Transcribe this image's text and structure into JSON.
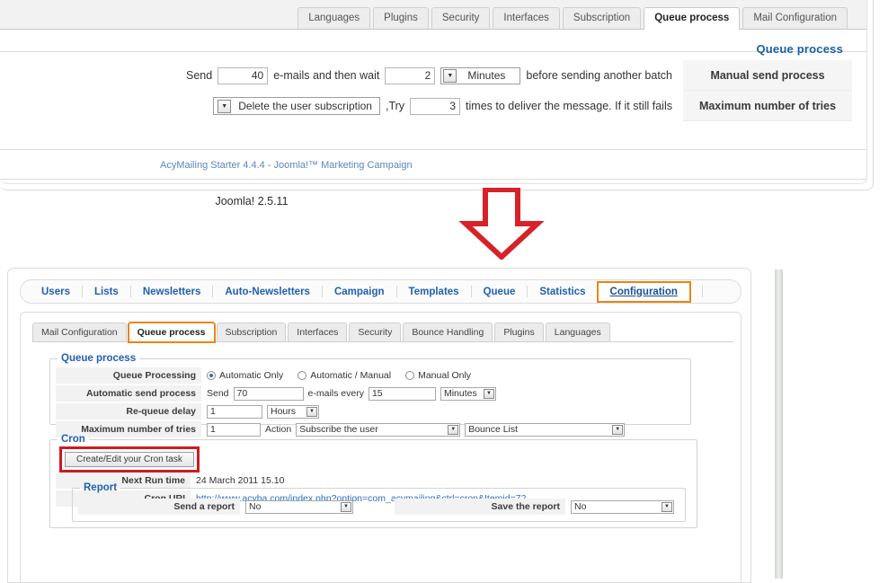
{
  "top_panel": {
    "tabs": [
      {
        "label": "Languages",
        "active": false
      },
      {
        "label": "Plugins",
        "active": false
      },
      {
        "label": "Security",
        "active": false
      },
      {
        "label": "Interfaces",
        "active": false
      },
      {
        "label": "Subscription",
        "active": false
      },
      {
        "label": "Queue process",
        "active": true
      },
      {
        "label": "Mail Configuration",
        "active": false
      }
    ],
    "legend": "Queue process",
    "row1": {
      "label_send": "Send",
      "emails_value": "40",
      "text_after_emails": "e-mails and then wait",
      "wait_value": "2",
      "unit": "Minutes",
      "text_tail": "before sending another batch",
      "side_label": "Manual send process"
    },
    "row2": {
      "action": "Delete the user subscription",
      "try_text": ",Try",
      "try_value": "3",
      "text_tail": "times to deliver the message. If it still fails",
      "side_label": "Maximum number of tries"
    },
    "acymailing_footer": "AcyMailing Starter 4.4.4 - Joomla!™ Marketing Campaign"
  },
  "middle": {
    "joomla_version": "Joomla! 2.5.11",
    "arrow_color": "#d82128"
  },
  "bottom_panel": {
    "main_nav": [
      {
        "label": "Users",
        "highlight": false
      },
      {
        "label": "Lists",
        "highlight": false
      },
      {
        "label": "Newsletters",
        "highlight": false
      },
      {
        "label": "Auto-Newsletters",
        "highlight": false
      },
      {
        "label": "Campaign",
        "highlight": false
      },
      {
        "label": "Templates",
        "highlight": false
      },
      {
        "label": "Queue",
        "highlight": false
      },
      {
        "label": "Statistics",
        "highlight": false
      },
      {
        "label": "Configuration",
        "highlight": true
      }
    ],
    "sub_tabs": [
      {
        "label": "Mail Configuration",
        "active": false
      },
      {
        "label": "Queue process",
        "active": true
      },
      {
        "label": "Subscription",
        "active": false
      },
      {
        "label": "Interfaces",
        "active": false
      },
      {
        "label": "Security",
        "active": false
      },
      {
        "label": "Bounce Handling",
        "active": false
      },
      {
        "label": "Plugins",
        "active": false
      },
      {
        "label": "Languages",
        "active": false
      }
    ],
    "queue_fieldset": {
      "legend": "Queue process",
      "queue_processing_label": "Queue Processing",
      "radios": [
        {
          "label": "Automatic Only",
          "selected": true
        },
        {
          "label": "Automatic / Manual",
          "selected": false
        },
        {
          "label": "Manual Only",
          "selected": false
        }
      ],
      "auto_send_label": "Automatic send process",
      "auto_send_prefix": "Send",
      "auto_send_count": "70",
      "auto_send_mid": "e-mails every",
      "auto_send_interval": "15",
      "auto_send_unit": "Minutes",
      "requeue_label": "Re-queue delay",
      "requeue_value": "1",
      "requeue_unit": "Hours",
      "max_tries_label": "Maximum number of tries",
      "max_tries_value": "1",
      "action_label": "Action",
      "action_value": "Subscribe the user",
      "list_value": "Bounce List"
    },
    "cron_fieldset": {
      "legend": "Cron",
      "button_label": "Create/Edit your Cron task",
      "next_run_label": "Next Run time",
      "next_run_value": "24 March 2011 15.10",
      "cron_uri_label": "Cron URI",
      "cron_uri_value": "http://www.acyba.com/index.php?option=com_acymailing&ctrl=cron&Itemid=72",
      "highlight_color": "#cc1b22",
      "report": {
        "legend": "Report",
        "send_label": "Send a report",
        "send_value": "No",
        "save_label": "Save the report",
        "save_value": "No"
      }
    },
    "highlight_color": "#ee8313"
  }
}
